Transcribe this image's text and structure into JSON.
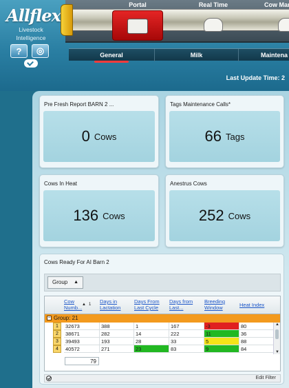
{
  "brand": {
    "logo_text": "Allflex",
    "tagline": "Livestock Intelligence",
    "help_label": "?",
    "globe_label": "◎"
  },
  "stations": [
    {
      "label": "Portal",
      "active": true
    },
    {
      "label": "Real Time",
      "active": false
    },
    {
      "label": "Cow Man",
      "active": false
    }
  ],
  "tabs": [
    {
      "label": "General",
      "active": true
    },
    {
      "label": "Milk",
      "active": false
    },
    {
      "label": "Maintena",
      "active": false
    }
  ],
  "update_label": "Last Update Time:  2",
  "cards": [
    {
      "title": "Pre Fresh Report BARN 2 ...",
      "value": "0",
      "unit": "Cows"
    },
    {
      "title": "Tags Maintenance Calls*",
      "value": "66",
      "unit": "Tags"
    },
    {
      "title": "Cows In Heat",
      "value": "136",
      "unit": "Cows"
    },
    {
      "title": "Anestrus Cows",
      "value": "252",
      "unit": "Cows"
    }
  ],
  "table": {
    "title": "Cows Ready For AI Barn 2",
    "group_button": "Group",
    "headers": [
      "Cow Numb...",
      "Days in Lactation",
      "Days From Last Cycle",
      "Days from Last...",
      "Breeding Window",
      "Heat Index"
    ],
    "sort_index": "1",
    "group_label": "Group: 21",
    "rows": [
      {
        "n": "1",
        "cow": "32673",
        "dil": "388",
        "dflc": "1",
        "dfl": "167",
        "bw": "-3",
        "bw_color": "#e02020",
        "hi": "80",
        "dflc_color": ""
      },
      {
        "n": "2",
        "cow": "38671",
        "dil": "282",
        "dflc": "14",
        "dfl": "222",
        "bw": "11",
        "bw_color": "#22b822",
        "hi": "36",
        "dflc_color": ""
      },
      {
        "n": "3",
        "cow": "39493",
        "dil": "193",
        "dflc": "28",
        "dfl": "33",
        "bw": "5",
        "bw_color": "#f4e418",
        "hi": "88",
        "dflc_color": ""
      },
      {
        "n": "4",
        "cow": "40572",
        "dil": "271",
        "dflc": "23",
        "dfl": "83",
        "bw": "9",
        "bw_color": "#22b822",
        "hi": "84",
        "dflc_color": "#22b822"
      }
    ],
    "summary_count": "79",
    "edit_filter": "Edit Filter"
  }
}
